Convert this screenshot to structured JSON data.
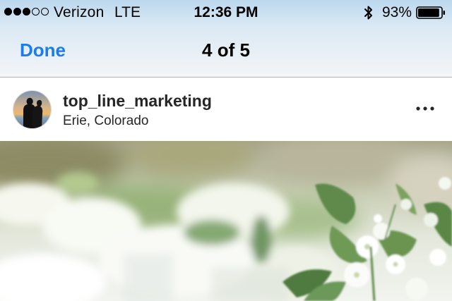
{
  "status_bar": {
    "carrier": "Verizon",
    "network": "LTE",
    "time": "12:36 PM",
    "battery_percent": "93%",
    "signal_bars_filled": 3,
    "signal_bars_total": 5,
    "battery_level": 0.93,
    "bluetooth_icon": "bluetooth-icon",
    "battery_icon": "battery-icon"
  },
  "nav": {
    "done_label": "Done",
    "title": "4 of 5",
    "accent_color": "#1b7ded"
  },
  "post": {
    "username": "top_line_marketing",
    "location": "Erie, Colorado",
    "avatar_icon": "profile-avatar",
    "more_icon": "more-options-icon",
    "photo_description_icon": "post-photo"
  }
}
